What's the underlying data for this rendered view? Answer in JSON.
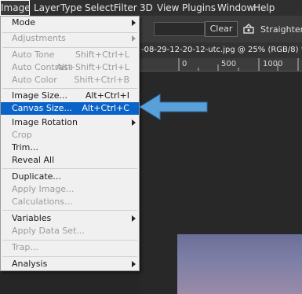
{
  "menubar": {
    "items": [
      "Image",
      "Layer",
      "Type",
      "Select",
      "Filter",
      "3D",
      "View",
      "Plugins",
      "Window",
      "Help"
    ]
  },
  "options_bar": {
    "clear_label": "Clear",
    "straighten_label": "Straighten"
  },
  "document": {
    "tab_title": "-08-29-12-20-12-utc.jpg @ 25% (RGB/8) *",
    "ruler_labels": [
      "0",
      "500",
      "1000"
    ]
  },
  "image_menu": {
    "mode": "Mode",
    "adjustments": "Adjustments",
    "auto_tone": {
      "label": "Auto Tone",
      "shortcut": "Shift+Ctrl+L"
    },
    "auto_contrast": {
      "label": "Auto Contrast",
      "shortcut": "Alt+Shift+Ctrl+L"
    },
    "auto_color": {
      "label": "Auto Color",
      "shortcut": "Shift+Ctrl+B"
    },
    "image_size": {
      "label": "Image Size...",
      "shortcut": "Alt+Ctrl+I"
    },
    "canvas_size": {
      "label": "Canvas Size...",
      "shortcut": "Alt+Ctrl+C"
    },
    "image_rotation": "Image Rotation",
    "crop": "Crop",
    "trim": "Trim...",
    "reveal_all": "Reveal All",
    "duplicate": "Duplicate...",
    "apply_image": "Apply Image...",
    "calculations": "Calculations...",
    "variables": "Variables",
    "apply_data_set": "Apply Data Set...",
    "trap": "Trap...",
    "analysis": "Analysis"
  },
  "colors": {
    "highlight": "#0a64c8",
    "annotation_arrow": "#5aa0d8"
  }
}
